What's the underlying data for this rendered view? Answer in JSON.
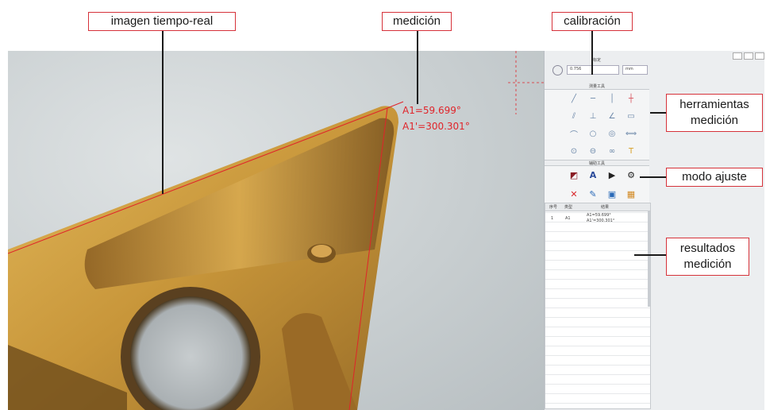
{
  "callouts": {
    "live_image": "imagen tiempo-real",
    "measurement": "medición",
    "calibration": "calibración",
    "tools_line1": "herramientas",
    "tools_line2": "medición",
    "adjust_mode": "modo ajuste",
    "results_line1": "resultados",
    "results_line2": "medición"
  },
  "overlay": {
    "angle1": "A1=59.699°",
    "angle2": "A1'=300.301°"
  },
  "panel": {
    "calibration_title": "标定",
    "calibration_value": "0.756",
    "unit": "mm",
    "tools_title": "测量工具",
    "adjust_title": "辅助工具",
    "results_header": [
      "序号",
      "类型",
      "结果"
    ],
    "results_rows": [
      {
        "no": "1",
        "type": "A1",
        "result1": "A1=59.699°",
        "result2": "A1'=300.301°"
      }
    ]
  },
  "colors": {
    "callout_border": "#d6323a",
    "overlay_text": "#e0242a",
    "insert_gold": "#c89a3a"
  },
  "icons": {
    "tools": [
      "line-icon",
      "horizontal-line-icon",
      "vertical-line-icon",
      "crosshair-icon",
      "parallel-line-icon",
      "perpendicular-icon",
      "angle-icon",
      "rectangle-icon",
      "arc-icon",
      "circle-icon",
      "concentric-circle-icon",
      "distance-icon",
      "point-circle-icon",
      "circle-line-icon",
      "two-circle-icon",
      "text-icon"
    ],
    "adjust": [
      "color-fill-icon",
      "text-style-icon",
      "play-icon",
      "settings-icon",
      "delete-icon",
      "edit-icon",
      "save-image-icon",
      "export-image-icon"
    ]
  }
}
